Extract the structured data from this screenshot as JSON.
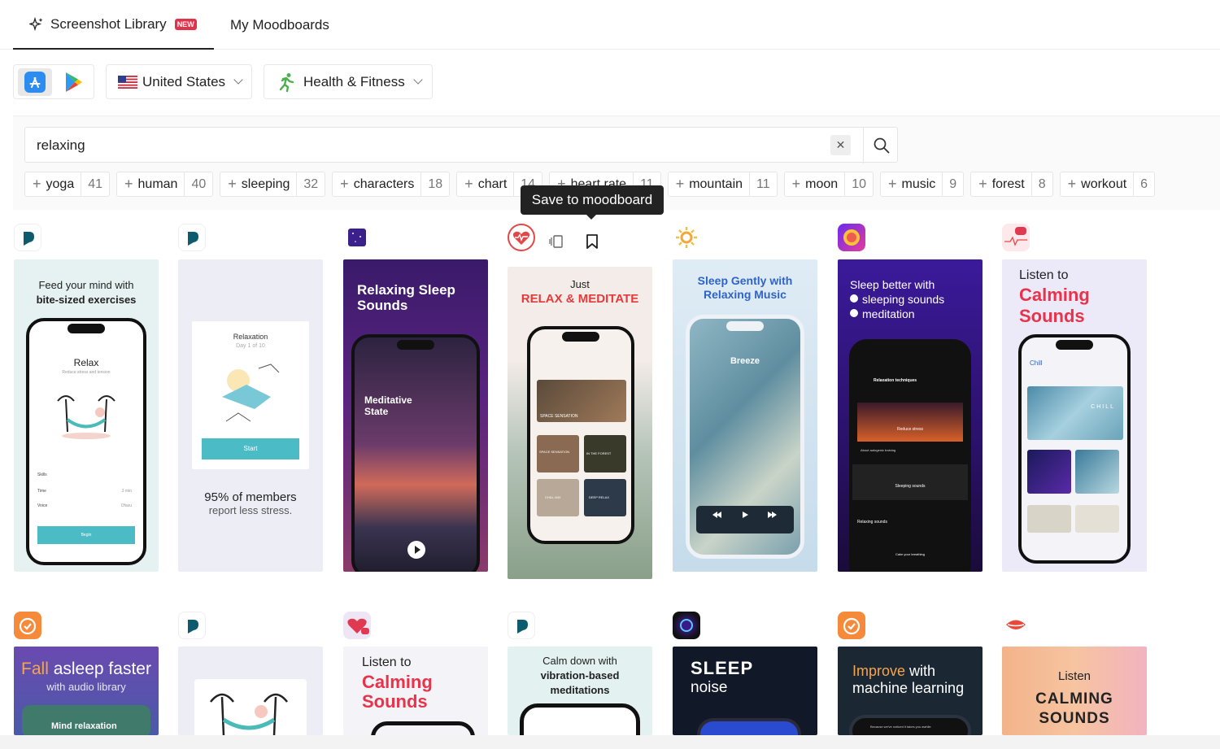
{
  "tabs": {
    "library": "Screenshot Library",
    "new_badge": "NEW",
    "moodboards": "My Moodboards"
  },
  "filters": {
    "country": "United States",
    "category": "Health & Fitness"
  },
  "search": {
    "query": "relaxing"
  },
  "chips": [
    {
      "label": "yoga",
      "count": "41"
    },
    {
      "label": "human",
      "count": "40"
    },
    {
      "label": "sleeping",
      "count": "32"
    },
    {
      "label": "characters",
      "count": "18"
    },
    {
      "label": "chart",
      "count": "14"
    },
    {
      "label": "heart rate",
      "count": "11"
    },
    {
      "label": "mountain",
      "count": "11"
    },
    {
      "label": "moon",
      "count": "10"
    },
    {
      "label": "music",
      "count": "9"
    },
    {
      "label": "forest",
      "count": "8"
    },
    {
      "label": "workout",
      "count": "6"
    }
  ],
  "tooltip": "Save to moodboard",
  "row1": {
    "c1": {
      "line1": "Feed your mind with",
      "line2": "bite-sized exercises",
      "screen": "Relax",
      "sub": "Reduce stress and tension",
      "rows": [
        "Skills",
        "Time",
        "Voice"
      ],
      "time_val": "3 min",
      "voice_val": "Ofasu",
      "begin": "Begin"
    },
    "c2": {
      "card_title": "Relaxation",
      "card_sub": "Day 1 of 10",
      "start": "Start",
      "caption1": "95% of members",
      "caption2": "report less stress."
    },
    "c3": {
      "title": "Relaxing Sleep Sounds",
      "state": "Meditative State"
    },
    "c4": {
      "line1": "Just",
      "line2": "RELAX & MEDITATE",
      "banner": "SPACE SENSATION",
      "t1": "SPACE SENSATION",
      "t2": "IN THE FOREST",
      "t3": "CHILL MIX",
      "t4": "DEEP RELAX"
    },
    "c5": {
      "title": "Sleep Gently with Relaxing Music",
      "screen": "Breeze"
    },
    "c6": {
      "line1": "Sleep better with",
      "line2": "sleeping sounds",
      "line3": "meditation",
      "t1": "Relaxation techniques",
      "t2": "Reduce stress",
      "t3": "About autogenic training",
      "t4": "Sleeping sounds",
      "t5": "Relaxing sounds",
      "t6": "Calm your breathing"
    },
    "c7": {
      "line1": "Listen to",
      "line2": "Calming",
      "line3": "Sounds",
      "screen": "Chill",
      "banner": "CHILL"
    }
  },
  "row2": {
    "c1": {
      "line1a": "Fall",
      "line1b": " asleep faster",
      "line2": "with audio library",
      "card": "Mind relaxation"
    },
    "c3": {
      "line1": "Listen to",
      "line2": "Calming",
      "line3": "Sounds"
    },
    "c4": {
      "line1": "Calm down with",
      "line2": "vibration-based",
      "line3": "meditations"
    },
    "c5": {
      "line1": "SLEEP",
      "line2": "noise"
    },
    "c6": {
      "line1a": "Improve",
      "line1b": " with",
      "line2": "machine learning",
      "foot": "Because we've noticed it takes you awhile"
    },
    "c7": {
      "line1": "Listen",
      "line2": "CALMING",
      "line3": "SOUNDS"
    }
  }
}
